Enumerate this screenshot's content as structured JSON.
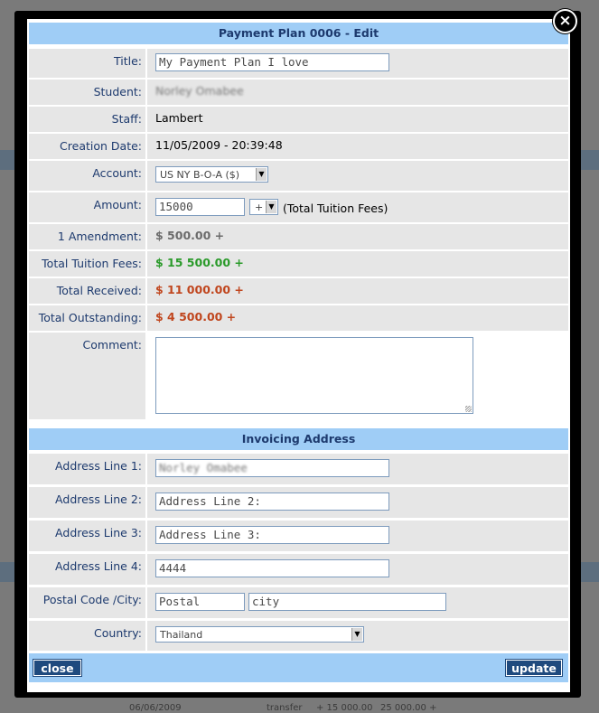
{
  "dialog": {
    "title": "Payment Plan 0006 - Edit",
    "close_icon": "close-icon"
  },
  "fields": {
    "title": {
      "label": "Title:",
      "value": "My Payment Plan I love"
    },
    "student": {
      "label": "Student:",
      "value": "Norley Omabee"
    },
    "staff": {
      "label": "Staff:",
      "value": "Lambert"
    },
    "creation_date": {
      "label": "Creation Date:",
      "value": "11/05/2009 - 20:39:48"
    },
    "account": {
      "label": "Account:",
      "value": "US NY B-O-A ($)"
    },
    "amount": {
      "label": "Amount:",
      "value": "15000",
      "operator": "+",
      "note": "(Total Tuition Fees)"
    },
    "amendment": {
      "label": "1 Amendment:",
      "value": "$ 500.00 +"
    },
    "total_tuition": {
      "label": "Total Tuition Fees:",
      "value": "$ 15 500.00 +"
    },
    "total_received": {
      "label": "Total Received:",
      "value": "$ 11 000.00 +"
    },
    "total_outstanding": {
      "label": "Total Outstanding:",
      "value": "$ 4 500.00 +"
    },
    "comment": {
      "label": "Comment:",
      "value": ""
    }
  },
  "invoicing": {
    "header": "Invoicing Address",
    "address1": {
      "label": "Address Line 1:",
      "value": "Norley Omabee"
    },
    "address2": {
      "label": "Address Line 2:",
      "placeholder": "Address Line 2:"
    },
    "address3": {
      "label": "Address Line 3:",
      "placeholder": "Address Line 3:"
    },
    "address4": {
      "label": "Address Line 4:",
      "value": "4444"
    },
    "postal_city": {
      "label": "Postal Code /City:",
      "postal_placeholder": "Postal",
      "city_placeholder": "city"
    },
    "country": {
      "label": "Country:",
      "value": "Thailand"
    }
  },
  "buttons": {
    "close": "close",
    "update": "update"
  },
  "colors": {
    "header_bg": "#9fcdf6",
    "label_text": "#1d3a6e",
    "amendment": "#6b6b6b",
    "tuition": "#2a9a2a",
    "received": "#c0461e",
    "outstanding": "#c0461e",
    "button_bg": "#1f4a7e"
  },
  "background": {
    "bottom_row": [
      "06/06/2009",
      "transfer",
      "+ 15 000.00",
      "25 000.00 +"
    ]
  }
}
